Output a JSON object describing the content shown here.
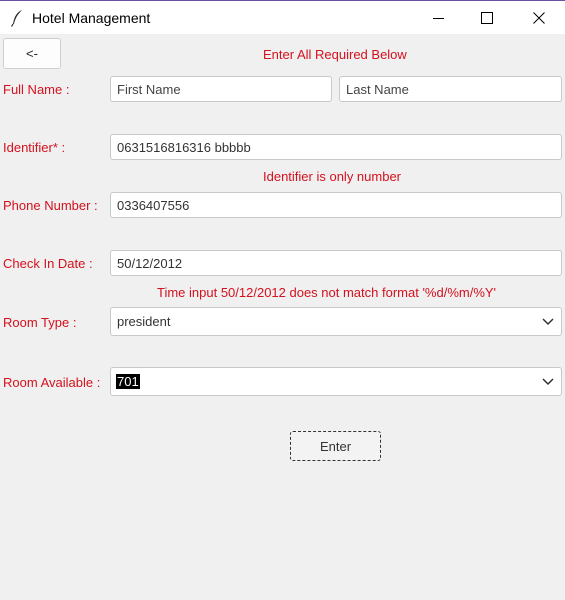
{
  "window": {
    "title": "Hotel Management"
  },
  "icons": {
    "app": "feather-icon",
    "minimize": "minimize-icon",
    "maximize": "maximize-icon",
    "close": "close-icon",
    "dropdown": "chevron-down-icon"
  },
  "colors": {
    "label": "#d4111e",
    "error": "#d4111e",
    "background": "#f0f0f0"
  },
  "form": {
    "back_label": "<-",
    "header_message": "Enter All Required Below",
    "full_name": {
      "label": "Full Name :",
      "first_placeholder": "First Name",
      "last_placeholder": "Last Name"
    },
    "identifier": {
      "label": "Identifier* :",
      "value": "0631516816316 bbbbb",
      "error": "Identifier is only number"
    },
    "phone": {
      "label": "Phone Number :",
      "value": "0336407556"
    },
    "check_in": {
      "label": "Check In Date :",
      "value": "50/12/2012",
      "error": "Time input 50/12/2012 does not match format '%d/%m/%Y'"
    },
    "room_type": {
      "label": "Room Type :",
      "value": "president"
    },
    "room_available": {
      "label": "Room Available :",
      "value": "701"
    },
    "enter_label": "Enter"
  }
}
